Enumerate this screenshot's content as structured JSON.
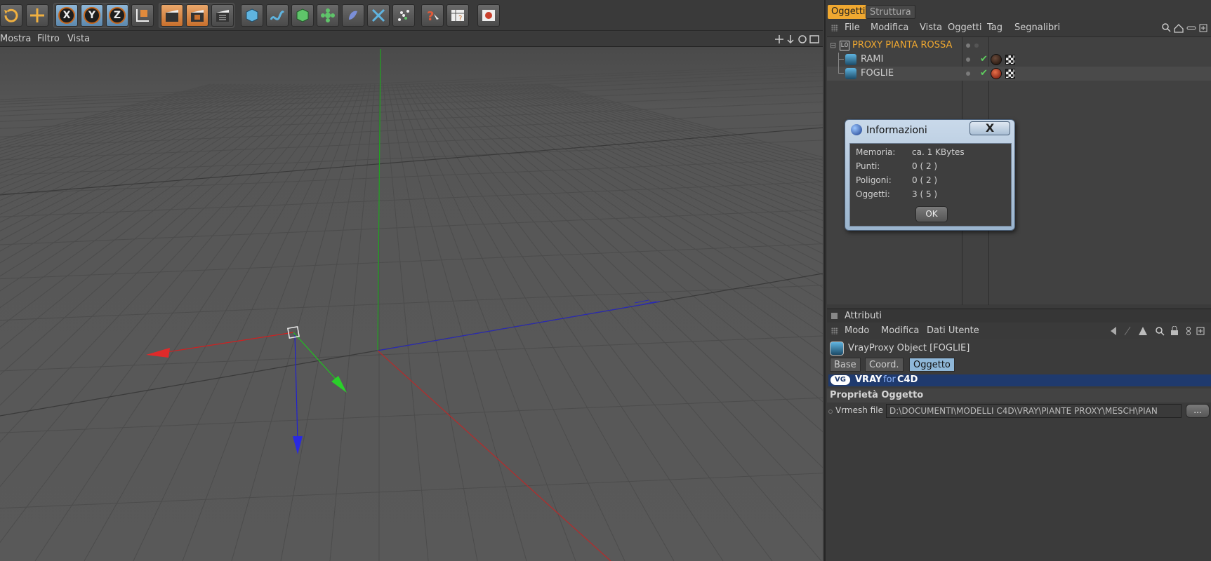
{
  "viewport_menu": {
    "items": [
      "Mostra",
      "Filtro",
      "Vista"
    ]
  },
  "toolbar": {
    "axis_labels": [
      "X",
      "Y",
      "Z"
    ]
  },
  "right_panel": {
    "tabs": [
      "Oggetti",
      "Struttura"
    ],
    "menu": [
      "File",
      "Modifica",
      "Vista",
      "Oggetti",
      "Tag",
      "Segnalibri"
    ],
    "objects": [
      {
        "name": "PROXY PIANTA ROSSA",
        "color": "#f0a830",
        "icon": "null-object-icon"
      },
      {
        "name": "RAMI",
        "color": "#cfcfcf",
        "icon": "vrayproxy-icon",
        "material": "#2a1a12"
      },
      {
        "name": "FOGLIE",
        "color": "#cfcfcf",
        "icon": "vrayproxy-icon",
        "material": "#b83a1c"
      }
    ]
  },
  "dialog": {
    "title": "Informazioni",
    "close_label": "X",
    "rows": [
      {
        "label": "Memoria:",
        "value": "ca. 1 KBytes"
      },
      {
        "label": "Punti:",
        "value": "0 ( 2 )"
      },
      {
        "label": "Poligoni:",
        "value": "0 ( 2 )"
      },
      {
        "label": "Oggetti:",
        "value": "3 ( 5 )"
      }
    ],
    "ok_label": "OK"
  },
  "attributes": {
    "title": "Attributi",
    "menu": [
      "Modo",
      "Modifica",
      "Dati Utente"
    ],
    "object_title": "VrayProxy Object [FOGLIE]",
    "tabs": [
      "Base",
      "Coord.",
      "Oggetto"
    ],
    "active_tab": "Oggetto",
    "banner_vray": "VRAY",
    "banner_for": "for",
    "banner_c4d": "C4D",
    "section_title": "Proprietà Oggetto",
    "vrmesh_label": "Vrmesh file",
    "vrmesh_value": "D:\\DOCUMENTI\\MODELLI C4D\\VRAY\\PIANTE PROXY\\MESCH\\PIAN",
    "browse_label": "..."
  },
  "colors": {
    "accent_orange": "#f0a830",
    "active_tab_blue": "#8fb7d8",
    "banner_blue": "#1f3a6e"
  }
}
